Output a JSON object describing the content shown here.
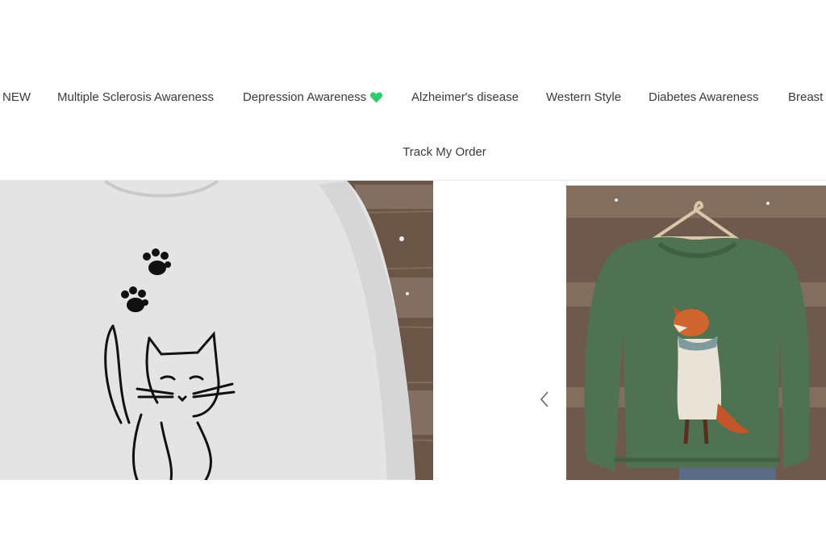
{
  "nav": {
    "items": [
      {
        "label": "NEW"
      },
      {
        "label": "Multiple Sclerosis Awareness"
      },
      {
        "label": "Depression Awareness",
        "icon": "green-heart-icon"
      },
      {
        "label": "Alzheimer's disease"
      },
      {
        "label": "Western Style"
      },
      {
        "label": "Diabetes Awareness"
      },
      {
        "label": "Breast"
      }
    ],
    "secondary": {
      "label": "Track My Order"
    }
  },
  "carousel": {
    "products": [
      {
        "image": "white sweatshirt with cat line art and paw prints"
      },
      {
        "image": "green sweatshirt with fox in scarf print on hanger"
      }
    ],
    "prev_icon": "chevron-left-icon"
  },
  "colors": {
    "heart": "#2ecc71",
    "nav_text": "#3a3a3a",
    "divider": "#e6e6e6"
  }
}
